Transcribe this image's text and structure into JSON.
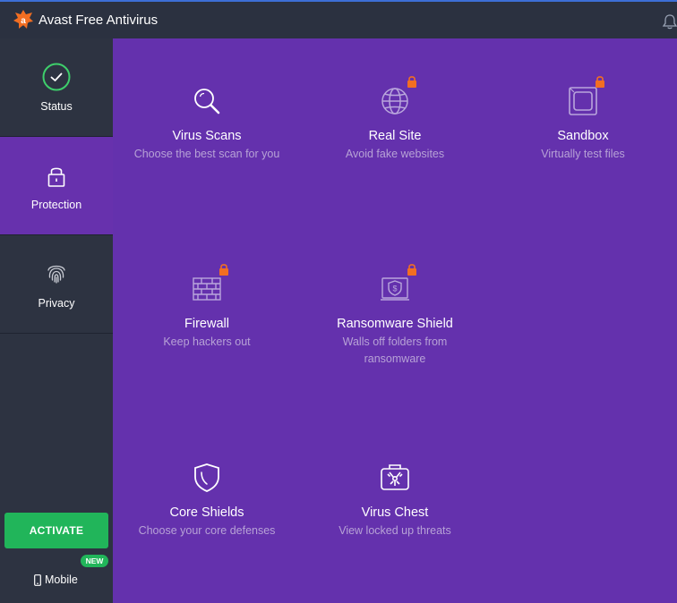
{
  "app": {
    "title": "Avast Free Antivirus"
  },
  "sidebar": {
    "items": [
      {
        "label": "Status",
        "icon": "check-circle-icon"
      },
      {
        "label": "Protection",
        "icon": "lock-icon",
        "active": true
      },
      {
        "label": "Privacy",
        "icon": "fingerprint-icon"
      }
    ],
    "activate_label": "ACTIVATE",
    "mobile_label": "Mobile",
    "new_badge": "NEW"
  },
  "features": [
    {
      "title": "Virus Scans",
      "subtitle": "Choose the best scan for you",
      "icon": "magnifier-icon",
      "locked": false
    },
    {
      "title": "Real Site",
      "subtitle": "Avoid fake websites",
      "icon": "globe-icon",
      "locked": true
    },
    {
      "title": "Sandbox",
      "subtitle": "Virtually test files",
      "icon": "sandbox-icon",
      "locked": true
    },
    {
      "title": "Firewall",
      "subtitle": "Keep hackers out",
      "icon": "firewall-icon",
      "locked": true
    },
    {
      "title": "Ransomware Shield",
      "subtitle": "Walls off folders from ransomware",
      "icon": "ransomware-shield-icon",
      "locked": true
    },
    {
      "title": "Core Shields",
      "subtitle": "Choose your core defenses",
      "icon": "shield-icon",
      "locked": false
    },
    {
      "title": "Virus Chest",
      "subtitle": "View locked up threats",
      "icon": "virus-chest-icon",
      "locked": false
    }
  ],
  "colors": {
    "accent_purple": "#6431ad",
    "sidebar_bg": "#2d3341",
    "activate_green": "#21b55a",
    "lock_orange": "#f26e22",
    "status_green": "#3ecf6b",
    "subtitle_text": "#b7a2d6"
  }
}
